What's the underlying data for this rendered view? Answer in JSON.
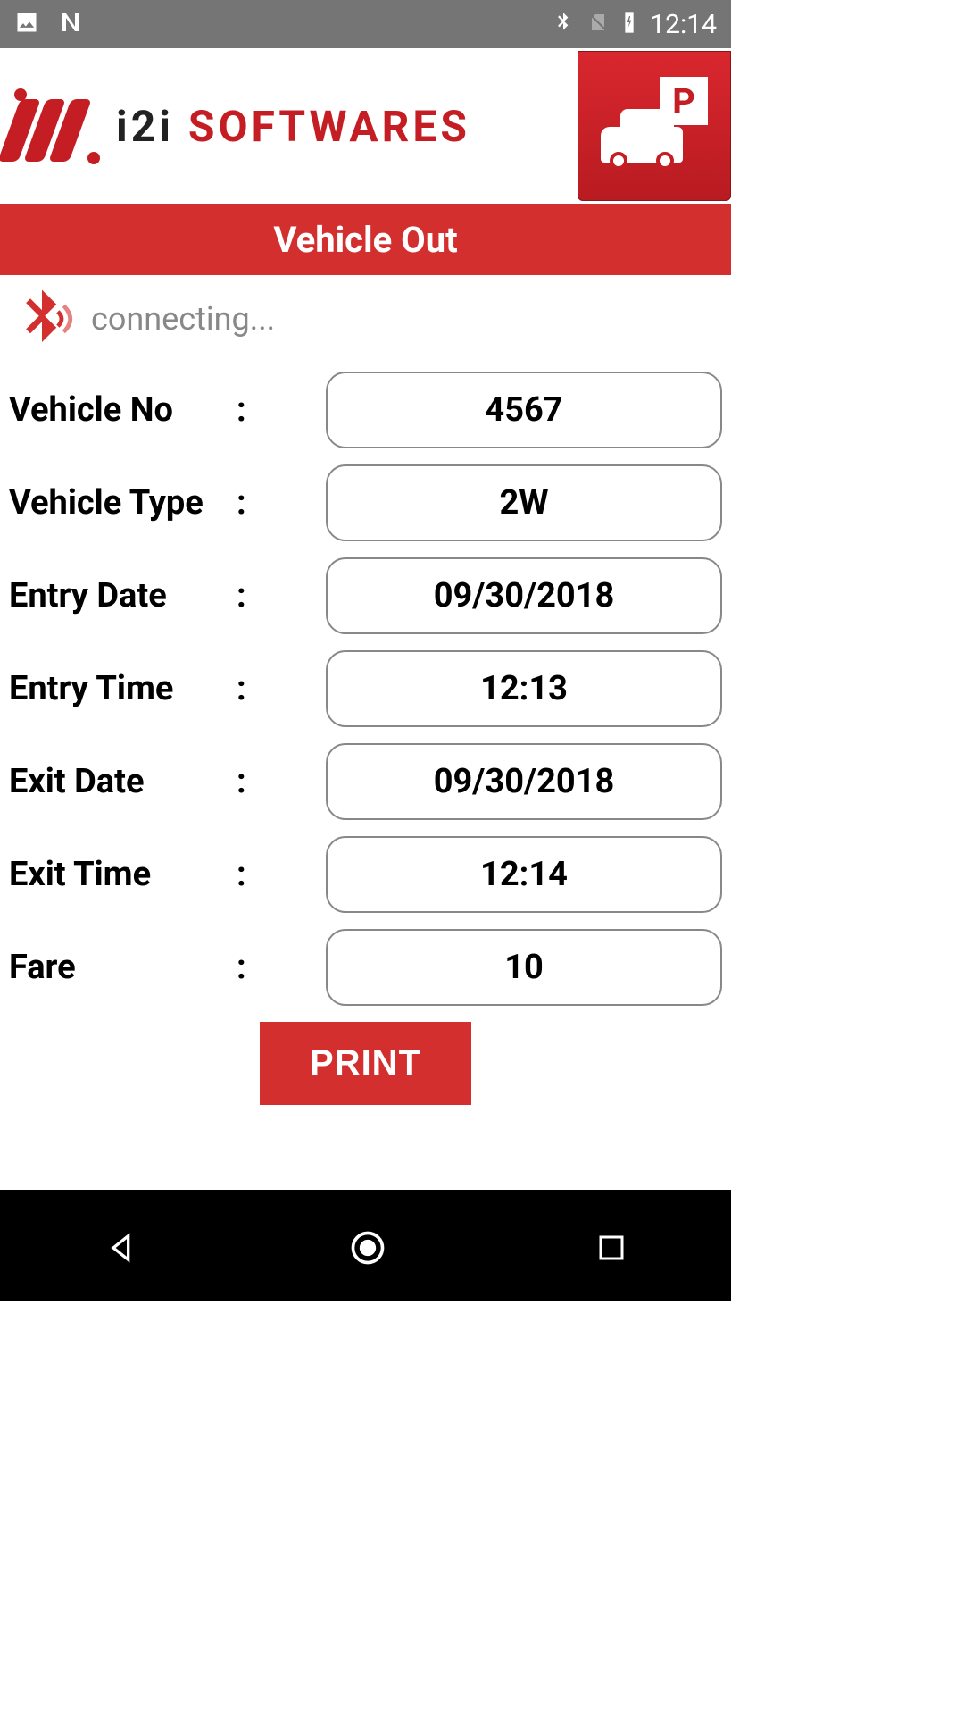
{
  "status": {
    "time": "12:14"
  },
  "header": {
    "logo_i2i": "i2i",
    "logo_soft": " SOFTWARES",
    "park_letter": "P"
  },
  "title": "Vehicle Out",
  "bluetooth": {
    "status": "connecting..."
  },
  "fields": [
    {
      "label": "Vehicle No",
      "value": "4567"
    },
    {
      "label": "Vehicle Type",
      "value": "2W"
    },
    {
      "label": "Entry Date",
      "value": "09/30/2018"
    },
    {
      "label": "Entry Time",
      "value": "12:13"
    },
    {
      "label": "Exit Date",
      "value": "09/30/2018"
    },
    {
      "label": "Exit Time",
      "value": "12:14"
    },
    {
      "label": "Fare",
      "value": "10"
    }
  ],
  "print_label": "PRINT",
  "colon": ":"
}
